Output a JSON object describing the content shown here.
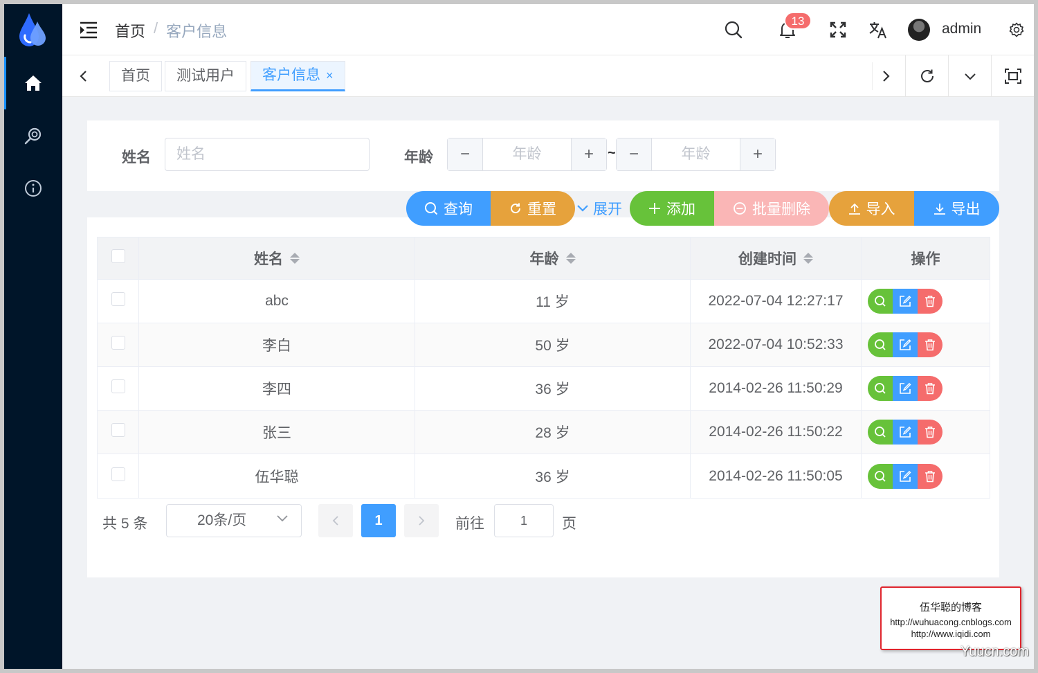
{
  "header": {
    "breadcrumb": [
      "首页",
      "客户信息"
    ],
    "breadcrumb_sep": "/",
    "notification_count": "13",
    "username": "admin"
  },
  "tabs": [
    {
      "label": "首页",
      "active": false
    },
    {
      "label": "测试用户",
      "active": false
    },
    {
      "label": "客户信息",
      "active": true,
      "close": "×"
    }
  ],
  "search": {
    "name_label": "姓名",
    "name_placeholder": "姓名",
    "age_label": "年龄",
    "age_min_placeholder": "年龄",
    "age_max_placeholder": "年龄",
    "range_sep": "~",
    "minus": "−",
    "plus": "+"
  },
  "toolbar": {
    "query": "查询",
    "reset": "重置",
    "expand": "展开",
    "add": "添加",
    "batch_delete": "批量删除",
    "import": "导入",
    "export": "导出"
  },
  "colors": {
    "primary": "#409eff",
    "success": "#67c23a",
    "warning": "#e6a23c",
    "danger": "#f56c6c",
    "danger_disabled": "#fab6b6",
    "sidebar": "#001529"
  },
  "table": {
    "columns": [
      "姓名",
      "年龄",
      "创建时间",
      "操作"
    ],
    "rows": [
      {
        "name": "abc",
        "age": "11 岁",
        "created": "2022-07-04 12:27:17"
      },
      {
        "name": "李白",
        "age": "50 岁",
        "created": "2022-07-04 10:52:33"
      },
      {
        "name": "李四",
        "age": "36 岁",
        "created": "2014-02-26 11:50:29"
      },
      {
        "name": "张三",
        "age": "28 岁",
        "created": "2014-02-26 11:50:22"
      },
      {
        "name": "伍华聪",
        "age": "36 岁",
        "created": "2014-02-26 11:50:05"
      }
    ],
    "row_actions": [
      "view-icon",
      "edit-icon",
      "delete-icon"
    ]
  },
  "pagination": {
    "total": "共 5 条",
    "page_size": "20条/页",
    "current_page": "1",
    "goto_label": "前往",
    "goto_value": "1",
    "page_unit": "页"
  },
  "watermark": {
    "line1": "伍华聪的博客",
    "line2": "http://wuhuacong.cnblogs.com",
    "line3": "http://www.iqidi.com",
    "site": "Yuucn.com"
  }
}
